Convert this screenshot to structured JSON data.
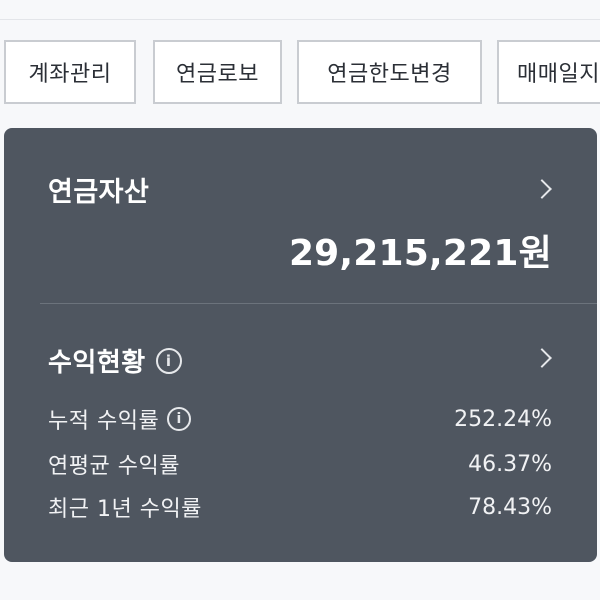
{
  "tabs": [
    {
      "label": "계좌관리"
    },
    {
      "label": "연금로보"
    },
    {
      "label": "연금한도변경"
    },
    {
      "label": "매매일지"
    }
  ],
  "asset": {
    "title": "연금자산",
    "amount": "29,215,221원"
  },
  "profit": {
    "title": "수익현황",
    "rows": [
      {
        "label": "누적 수익률",
        "value": "252.24%",
        "has_info": true
      },
      {
        "label": "연평균 수익률",
        "value": "46.37%",
        "has_info": false
      },
      {
        "label": "최근 1년 수익률",
        "value": "78.43%",
        "has_info": false
      }
    ]
  },
  "colors": {
    "card_bg": "#4f5660",
    "tab_border": "#c9ccd1",
    "page_bg": "#f7f8fa"
  },
  "icons": {
    "chevron": "chevron-right-icon",
    "info": "info-icon"
  }
}
